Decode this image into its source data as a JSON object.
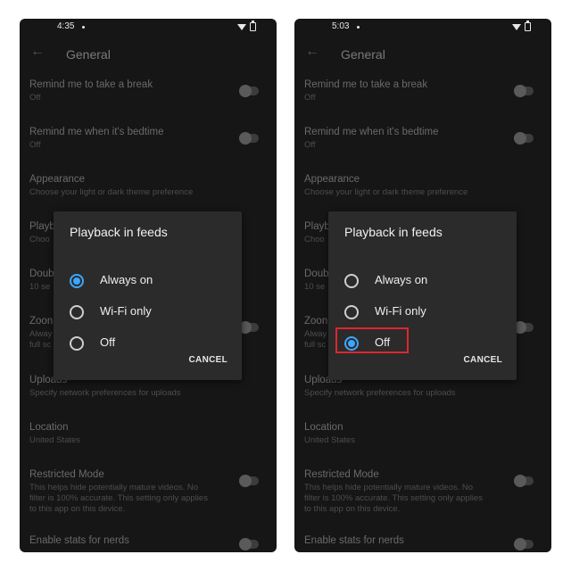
{
  "screens": [
    {
      "status_time": "4:35",
      "selected": 0,
      "highlight": false
    },
    {
      "status_time": "5:03",
      "selected": 2,
      "highlight": true
    }
  ],
  "header": {
    "title": "General",
    "back_icon": "arrow-back-icon"
  },
  "settings": [
    {
      "title": "Remind me to take a break",
      "subtitle": "Off",
      "toggle": true
    },
    {
      "title": "Remind me when it's bedtime",
      "subtitle": "Off",
      "toggle": true
    },
    {
      "title": "Appearance",
      "subtitle": "Choose your light or dark theme preference",
      "toggle": false
    },
    {
      "title": "Playb",
      "subtitle": "Choo",
      "toggle": false
    },
    {
      "title": "Doub",
      "subtitle": "10 se",
      "toggle": false
    },
    {
      "title": "Zoon",
      "subtitle": "Alway\nfull sc",
      "toggle": true
    },
    {
      "title": "Uploads",
      "subtitle": "Specify network preferences for uploads",
      "toggle": false
    },
    {
      "title": "Location",
      "subtitle": "United States",
      "toggle": false
    },
    {
      "title": "Restricted Mode",
      "subtitle": "This helps hide potentially mature videos. No filter is 100% accurate. This setting only applies to this app on this device.",
      "toggle": true
    },
    {
      "title": "Enable stats for nerds",
      "subtitle": "",
      "toggle": true
    }
  ],
  "dialog": {
    "title": "Playback in feeds",
    "options": [
      "Always on",
      "Wi-Fi only",
      "Off"
    ],
    "cancel_label": "CANCEL"
  },
  "colors": {
    "accent": "#3ea6ff",
    "highlight_box": "#e0262c",
    "background": "#161616",
    "dialog": "#2b2b2b"
  }
}
